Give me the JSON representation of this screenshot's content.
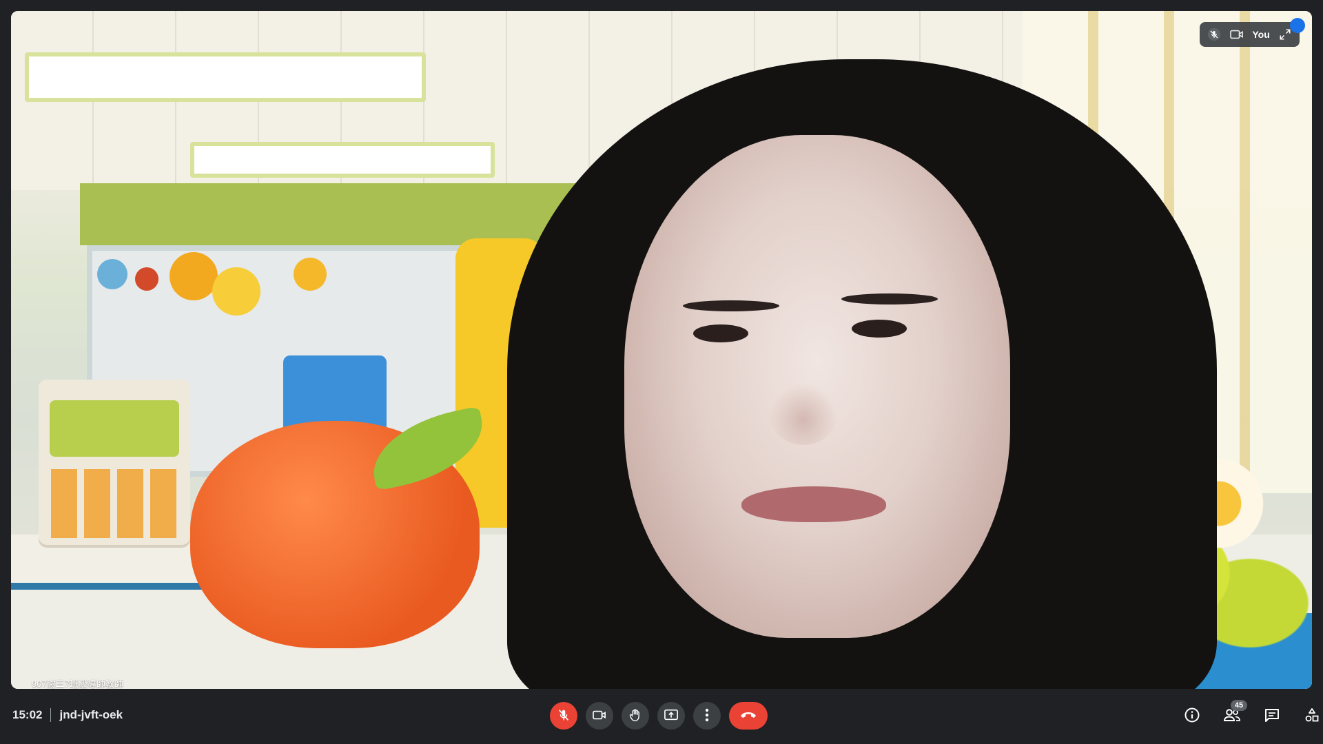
{
  "meeting": {
    "time": "15:02",
    "code": "jnd-jvft-oek"
  },
  "self_view": {
    "label": "You"
  },
  "video_caption": "907謝三7班級導師教師",
  "participants": {
    "count": "45"
  },
  "colors": {
    "background": "#202124",
    "control_bg": "#3c4043",
    "danger": "#ea4335",
    "accent": "#1a73e8"
  },
  "controls": {
    "left": [
      "mic-off-icon",
      "camera-icon",
      "raise-hand-icon",
      "present-icon",
      "more-options-icon",
      "end-call-icon"
    ],
    "right": [
      "info-icon",
      "people-icon",
      "chat-icon",
      "activities-icon"
    ]
  }
}
